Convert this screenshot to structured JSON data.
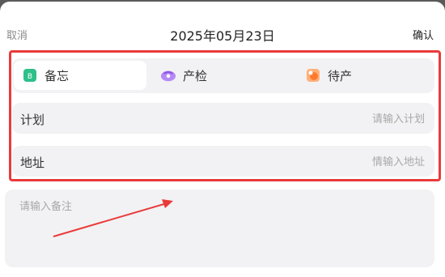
{
  "header": {
    "cancel_label": "取消",
    "date": "2025年05月23日",
    "confirm_label": "确认"
  },
  "type_tabs": [
    {
      "label": "备忘",
      "icon": "memo-icon",
      "icon_color": "#2ec08a",
      "active": true
    },
    {
      "label": "产检",
      "icon": "checkup-icon",
      "icon_color": "#a46cf0",
      "active": false
    },
    {
      "label": "待产",
      "icon": "delivery-icon",
      "icon_color": "#ff8a3d",
      "active": false
    }
  ],
  "plan_field": {
    "label": "计划",
    "placeholder": "请输入计划",
    "value": ""
  },
  "address_field": {
    "label": "地址",
    "placeholder": "情输入地址",
    "value": ""
  },
  "remark_field": {
    "placeholder": "请输入备注",
    "value": ""
  },
  "annotation": {
    "highlight_color": "#ea3a3a"
  }
}
